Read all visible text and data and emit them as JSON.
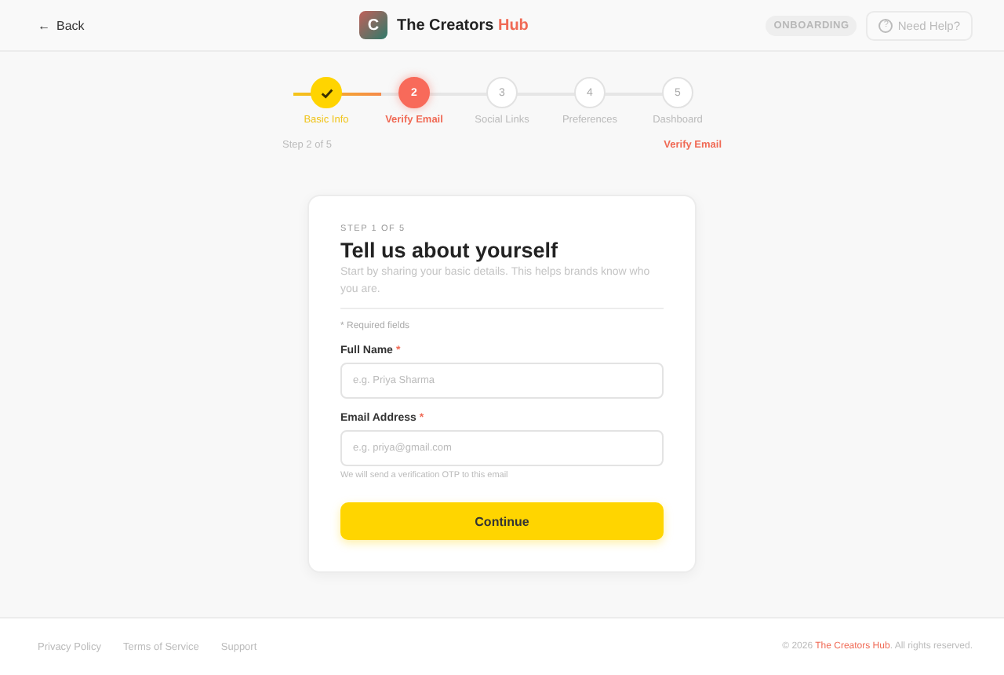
{
  "header": {
    "back": {
      "icon": "←",
      "label": "Back"
    },
    "logo_letter": "C",
    "title": "The Creators",
    "title_accent": "Hub",
    "badge": "ONBOARDING",
    "help": {
      "icon": "?",
      "label": "Need Help?"
    }
  },
  "stepper": {
    "steps": [
      {
        "label": "Basic Info",
        "completed": true,
        "selected": false
      },
      {
        "number": "2",
        "label": "Verify Email",
        "completed": false,
        "selected": true
      },
      {
        "number": "3",
        "label": "Social Links",
        "completed": false,
        "selected": false
      },
      {
        "number": "4",
        "label": "Preferences",
        "completed": false,
        "selected": false
      },
      {
        "number": "5",
        "label": "Dashboard",
        "completed": false,
        "selected": false
      }
    ],
    "progress_text": "Step 2 of 5",
    "current_label": "Verify Email"
  },
  "card": {
    "eyebrow": "STEP 1 OF 5",
    "title": "Tell us about yourself",
    "subtitle": "Start by sharing your basic details. This helps brands know who you are.",
    "required_note": "* Required fields",
    "fields": [
      {
        "label": "Full Name",
        "required_mark": "*",
        "placeholder": "e.g. Priya Sharma"
      },
      {
        "label": "Email Address",
        "required_mark": "*",
        "placeholder": "e.g. priya@gmail.com",
        "hint": "We will send a verification OTP to this email"
      }
    ],
    "button": "Continue"
  },
  "footer": {
    "links": [
      "Privacy Policy",
      "Terms of Service",
      "Support"
    ],
    "copyright_pre": "© 2026 ",
    "copyright_link": "The Creators Hub",
    "copyright_post": ". All rights reserved."
  }
}
